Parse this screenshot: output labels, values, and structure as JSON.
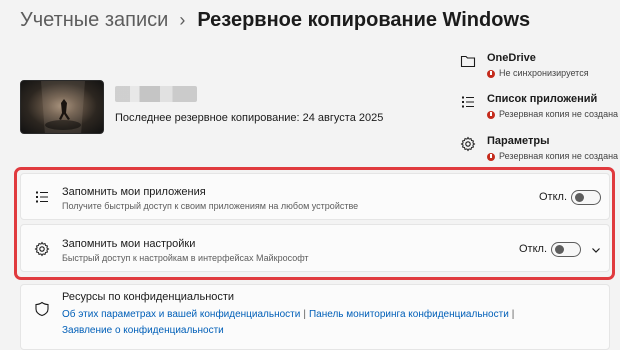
{
  "breadcrumb": {
    "parent": "Учетные записи",
    "separator": "›",
    "title": "Резервное копирование Windows"
  },
  "profile": {
    "last_backup": "Последнее резервное копирование: 24 августа 2025"
  },
  "status": [
    {
      "icon": "folder-icon",
      "title": "OneDrive",
      "subtitle": "Не синхронизируется"
    },
    {
      "icon": "app-list-icon",
      "title": "Список приложений",
      "subtitle": "Резервная копия не создана"
    },
    {
      "icon": "gear-icon",
      "title": "Параметры",
      "subtitle": "Резервная копия не создана"
    }
  ],
  "settings": [
    {
      "icon": "app-list-icon",
      "title": "Запомнить мои приложения",
      "description": "Получите быстрый доступ к своим приложениям на любом устройстве",
      "toggle_label": "Откл.",
      "toggle_on": false
    },
    {
      "icon": "gear-icon",
      "title": "Запомнить мои настройки",
      "description": "Быстрый доступ к настройкам в интерфейсах Майкрософт",
      "toggle_label": "Откл.",
      "toggle_on": false
    }
  ],
  "privacy": {
    "icon": "shield-icon",
    "title": "Ресурсы по конфиденциальности",
    "links": [
      "Об этих параметрах и вашей конфиденциальности",
      "Панель мониторинга конфиденциальности",
      "Заявление о конфиденциальности"
    ],
    "separator": "|"
  },
  "colors": {
    "accent": "#005fb8",
    "warning": "#c42b1c",
    "highlight": "#e03a3e"
  }
}
